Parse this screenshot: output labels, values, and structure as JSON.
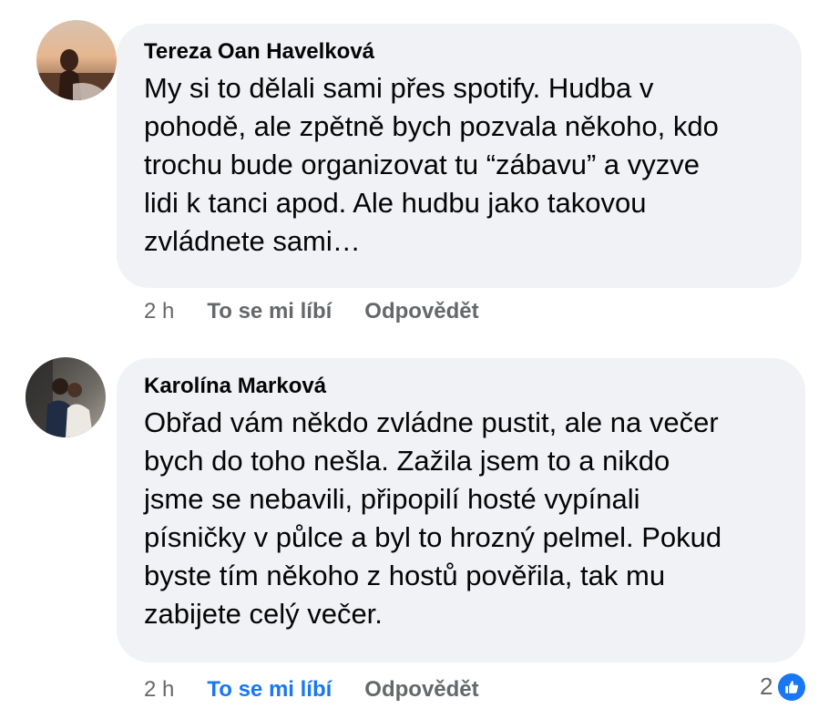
{
  "comments": [
    {
      "author": "Tereza Oan Havelková",
      "text": "My si to dělali sami přes spotify. Hudba v pohodě, ale zpětně bych pozvala někoho, kdo trochu bude organizovat tu “zábavu” a vyzve lidi k tanci apod. Ale hudbu jako takovou zvládnete sami…",
      "lines": [
        "My si to dělali sami přes spotify. Hudba v",
        "pohodě, ale zpětně bych pozvala někoho, kdo",
        "trochu bude organizovat tu “zábavu” a vyzve",
        "lidi k tanci apod. Ale hudbu jako takovou",
        "zvládnete sami…"
      ],
      "time": "2 h",
      "like_label": "To se mi líbí",
      "reply_label": "Odpovědět",
      "liked": false
    },
    {
      "author": "Karolína Marková",
      "text": "Obřad vám někdo zvládne pustit, ale na večer bych do toho nešla. Zažila jsem to a nikdo jsme se nebavili, připopilí hosté vypínali písničky v půlce a byl to hrozný pelmel. Pokud byste tím někoho z hostů pověřila, tak mu zabijete celý večer.",
      "lines": [
        "Obřad vám někdo zvládne pustit, ale na večer",
        "bych do toho nešla. Zažila jsem to a nikdo",
        "jsme se nebavili, připopilí hosté vypínali",
        "písničky v půlce a byl to hrozný pelmel. Pokud",
        "byste tím někoho z hostů pověřila, tak mu",
        "zabijete celý večer."
      ],
      "time": "2 h",
      "like_label": "To se mi líbí",
      "reply_label": "Odpovědět",
      "liked": true,
      "reaction_count": "2",
      "reaction_icon": "thumbs-up-icon"
    }
  ],
  "colors": {
    "bubble": "#f0f2f5",
    "meta": "#65676b",
    "liked": "#1877f2"
  }
}
